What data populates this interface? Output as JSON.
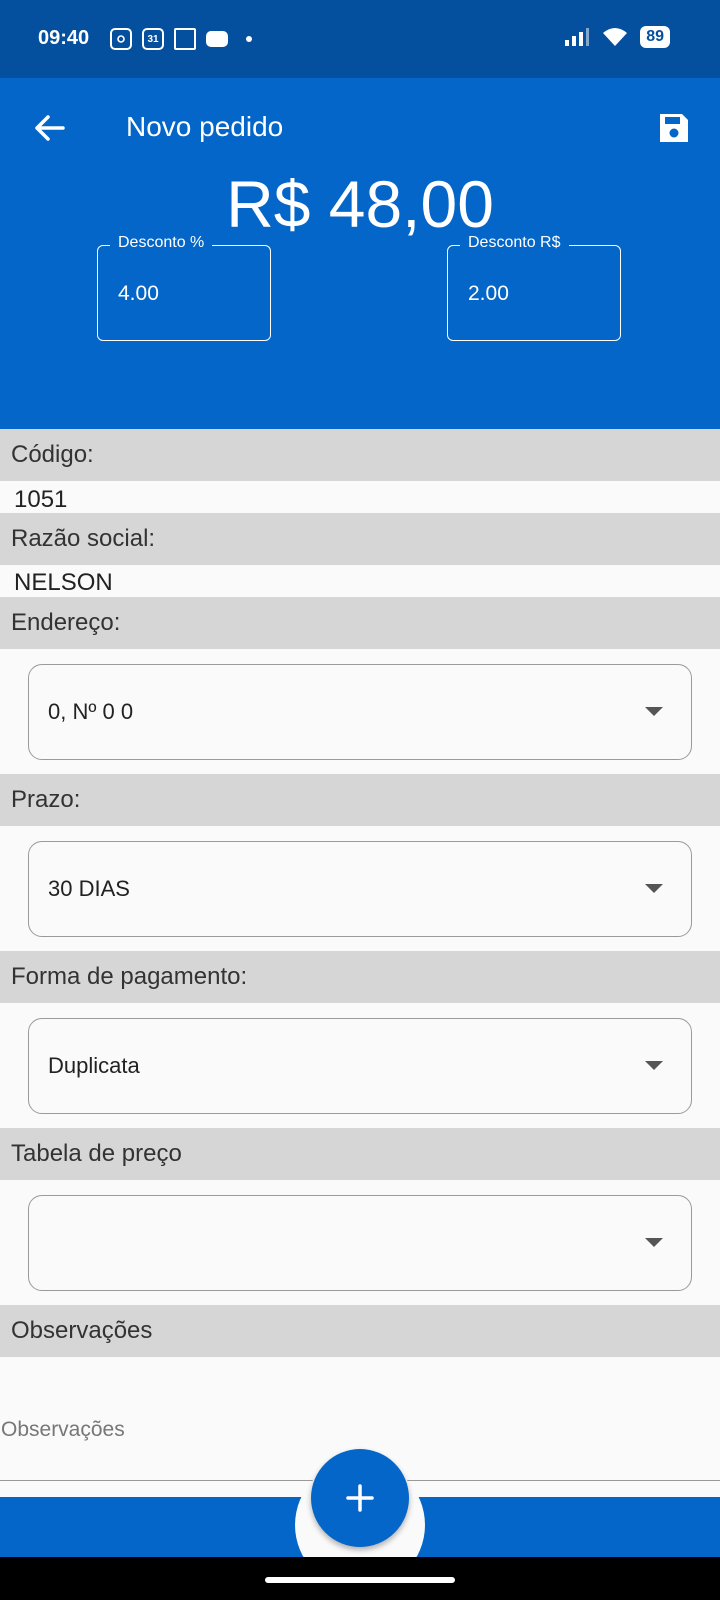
{
  "status_bar": {
    "time": "09:40",
    "battery": "89",
    "icons": [
      "instagram-icon",
      "calendar-icon",
      "notification-icon",
      "wallet-icon",
      "signal-icon",
      "wifi-icon",
      "battery-icon"
    ]
  },
  "app_bar": {
    "title": "Novo pedido",
    "total": "R$ 48,00",
    "back_icon": "arrow-left-icon",
    "save_icon": "save-icon",
    "color": "#0466c8"
  },
  "discount": {
    "percent_label": "Desconto %",
    "percent_value": "4.00",
    "amount_label": "Desconto R$",
    "amount_value": "2.00"
  },
  "fields": {
    "codigo_label": "Código:",
    "codigo_value": "1051",
    "razao_label": "Razão social:",
    "razao_value": "NELSON",
    "endereco_label": "Endereço:",
    "endereco_value": "0, Nº 0 0",
    "prazo_label": "Prazo:",
    "prazo_value": "30 DIAS",
    "pagamento_label": "Forma de pagamento:",
    "pagamento_value": "Duplicata",
    "tabela_label": "Tabela de preço",
    "tabela_value": "",
    "obs_label": "Observações",
    "obs_placeholder": "Observações"
  },
  "fab": {
    "icon": "plus-icon"
  }
}
